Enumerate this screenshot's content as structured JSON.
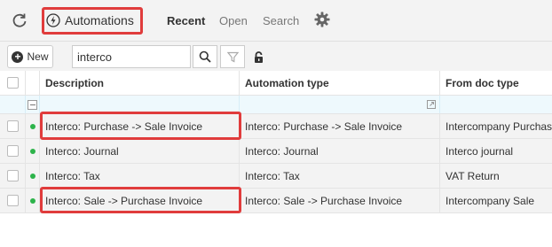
{
  "header": {
    "automations_label": "Automations",
    "tabs": [
      {
        "label": "Recent",
        "active": true
      },
      {
        "label": "Open",
        "active": false
      },
      {
        "label": "Search",
        "active": false
      }
    ]
  },
  "toolbar": {
    "new_label": "New",
    "search_value": "interco"
  },
  "table": {
    "columns": [
      "Description",
      "Automation type",
      "From doc type"
    ],
    "rows": [
      {
        "description": "Interco: Purchase -> Sale Invoice",
        "automation_type": "Interco: Purchase -> Sale Invoice",
        "from_doc_type": "Intercompany Purchase",
        "status": "active",
        "highlighted": true
      },
      {
        "description": "Interco: Journal",
        "automation_type": "Interco: Journal",
        "from_doc_type": "Interco journal",
        "status": "active",
        "highlighted": false
      },
      {
        "description": "Interco: Tax",
        "automation_type": "Interco: Tax",
        "from_doc_type": "VAT Return",
        "status": "active",
        "highlighted": false
      },
      {
        "description": "Interco: Sale -> Purchase Invoice",
        "automation_type": "Interco: Sale -> Purchase Invoice",
        "from_doc_type": "Intercompany Sale",
        "status": "active",
        "highlighted": true
      }
    ]
  },
  "colors": {
    "highlight": "#e03c3c",
    "status_active": "#2db34a",
    "filter_row": "#eef9fd"
  },
  "icons": [
    "refresh-icon",
    "lightning-icon",
    "gear-icon",
    "plus-icon",
    "search-icon",
    "filter-icon",
    "unlock-icon",
    "collapse-icon",
    "expand-icon"
  ]
}
